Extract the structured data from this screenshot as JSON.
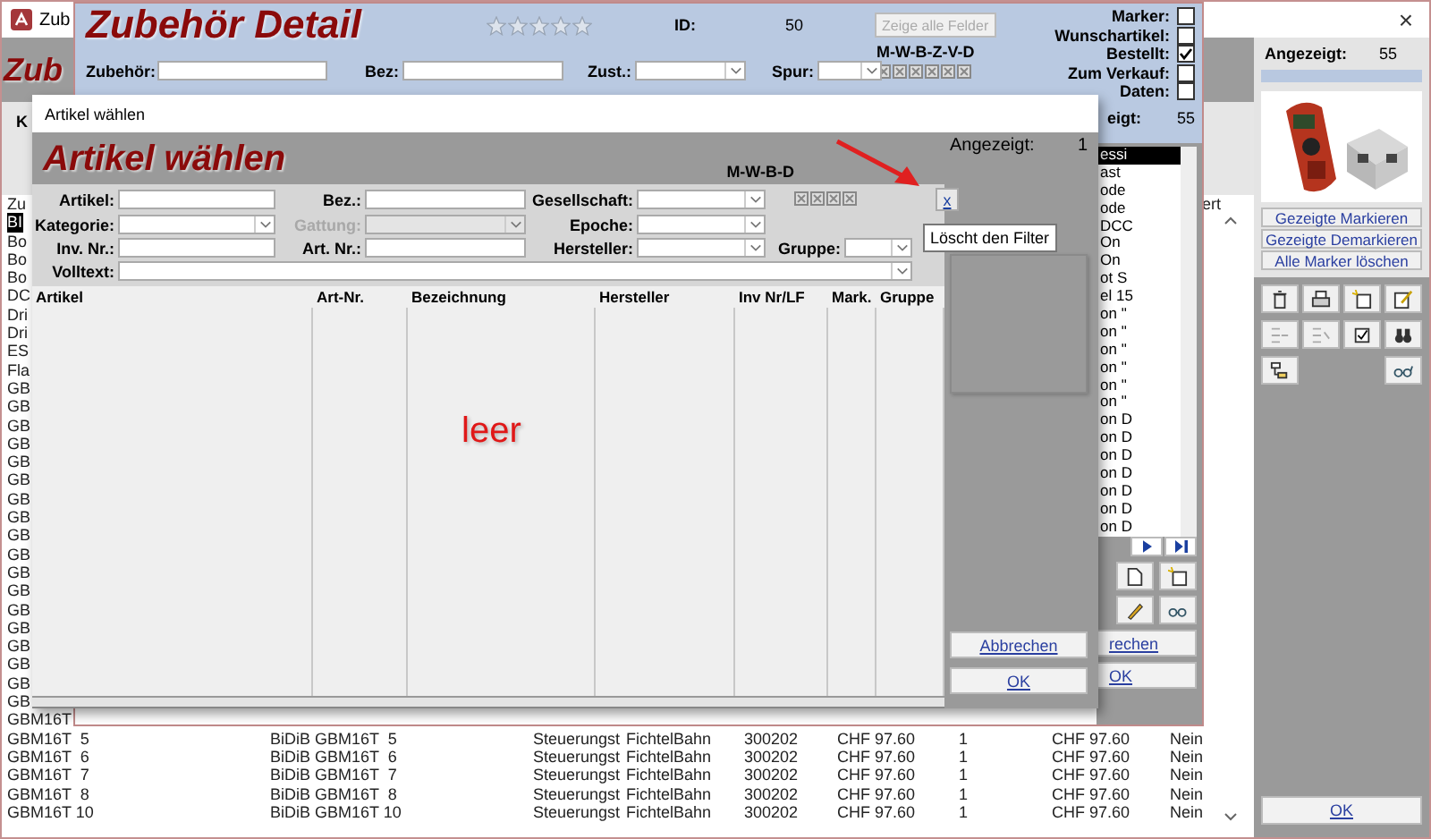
{
  "app_window": {
    "title": "Zub",
    "heading": "Zub",
    "close": "×",
    "filter_label": "K",
    "list_header": "Zu",
    "column_header": "ert",
    "rows": [
      {
        "cells": [
          "BI"
        ],
        "selected": true
      },
      {
        "cells": [
          "Bo"
        ],
        "selected": false
      },
      {
        "cells": [
          "Bo"
        ],
        "selected": false
      },
      {
        "cells": [
          "Bo"
        ],
        "selected": false
      },
      {
        "cells": [
          "DC"
        ],
        "selected": false
      },
      {
        "cells": [
          "Dri"
        ],
        "selected": false
      },
      {
        "cells": [
          "Dri"
        ],
        "selected": false
      },
      {
        "cells": [
          "ES"
        ],
        "selected": false
      },
      {
        "cells": [
          "Fla"
        ],
        "selected": false
      },
      {
        "cells": [
          "GB"
        ],
        "selected": false
      },
      {
        "cells": [
          "GB"
        ],
        "selected": false
      },
      {
        "cells": [
          "GB"
        ],
        "selected": false
      },
      {
        "cells": [
          "GB"
        ],
        "selected": false
      },
      {
        "cells": [
          "GB"
        ],
        "selected": false
      },
      {
        "cells": [
          "GB"
        ],
        "selected": false
      },
      {
        "cells": [
          "GB"
        ],
        "selected": false
      },
      {
        "cells": [
          "GB"
        ],
        "selected": false
      },
      {
        "cells": [
          "GB"
        ],
        "selected": false
      },
      {
        "cells": [
          "GB"
        ],
        "selected": false
      },
      {
        "cells": [
          "GB"
        ],
        "selected": false
      },
      {
        "cells": [
          "GB"
        ],
        "selected": false
      },
      {
        "cells": [
          "GB"
        ],
        "selected": false
      },
      {
        "cells": [
          "GB"
        ],
        "selected": false
      },
      {
        "cells": [
          "GB"
        ],
        "selected": false
      },
      {
        "cells": [
          "GB"
        ],
        "selected": false
      },
      {
        "cells": [
          "GB"
        ],
        "selected": false
      },
      {
        "cells": [
          "GB"
        ],
        "selected": false
      },
      {
        "cells": [
          "GBM16T"
        ],
        "selected": false
      },
      {
        "cells": [
          "GBM16T  5",
          "BiDiB GBM16T  5",
          "Steuerungst",
          "FichtelBahn",
          "300202",
          "CHF 97.60",
          "1",
          "CHF 97.60",
          "Nein"
        ],
        "selected": false
      },
      {
        "cells": [
          "GBM16T  6",
          "BiDiB GBM16T  6",
          "Steuerungst",
          "FichtelBahn",
          "300202",
          "CHF 97.60",
          "1",
          "CHF 97.60",
          "Nein"
        ],
        "selected": false
      },
      {
        "cells": [
          "GBM16T  7",
          "BiDiB GBM16T  7",
          "Steuerungst",
          "FichtelBahn",
          "300202",
          "CHF 97.60",
          "1",
          "CHF 97.60",
          "Nein"
        ],
        "selected": false
      },
      {
        "cells": [
          "GBM16T  8",
          "BiDiB GBM16T  8",
          "Steuerungst",
          "FichtelBahn",
          "300202",
          "CHF 97.60",
          "1",
          "CHF 97.60",
          "Nein"
        ],
        "selected": false
      },
      {
        "cells": [
          "GBM16T 10",
          "BiDiB GBM16T 10",
          "Steuerungst",
          "FichtelBahn",
          "300202",
          "CHF 97.60",
          "1",
          "CHF 97.60",
          "Nein"
        ],
        "selected": false
      }
    ],
    "side_panel": {
      "shown_label": "Angezeigt:",
      "shown_count": "55",
      "buttons": [
        "Gezeigte Markieren",
        "Gezeigte Demarkieren",
        "Alle Marker löschen"
      ],
      "ok_button": "OK"
    }
  },
  "detail_window": {
    "heading": "Zubehör Detail",
    "stars": 0,
    "id_label": "ID:",
    "id_value": "50",
    "show_all_button": {
      "label": "Zeige alle Felder",
      "disabled": true
    },
    "flags_label": "M-W-B-Z-V-D",
    "fields": [
      {
        "label": "Zubehör:",
        "kind": "text",
        "disabled": false
      },
      {
        "label": "Bez:",
        "kind": "text",
        "disabled": false
      },
      {
        "label": "Zust.:",
        "kind": "dropdown",
        "disabled": false
      },
      {
        "label": "Spur:",
        "kind": "dropdown",
        "disabled": false
      }
    ],
    "checks": [
      {
        "label": "Marker:",
        "checked": false
      },
      {
        "label": "Wunschartikel:",
        "checked": false
      },
      {
        "label": "Bestellt:",
        "checked": true
      },
      {
        "label": "Zum Verkauf:",
        "checked": false
      },
      {
        "label": "Daten:",
        "checked": false
      }
    ],
    "shown_label": "eigt:",
    "shown_count": "55",
    "list": [
      {
        "text": "essi",
        "selected": true
      },
      {
        "text": "ast",
        "selected": false
      },
      {
        "text": "ode",
        "selected": false
      },
      {
        "text": "ode",
        "selected": false
      },
      {
        "text": "DCC",
        "selected": false
      },
      {
        "text": "On",
        "selected": false
      },
      {
        "text": "On",
        "selected": false
      },
      {
        "text": "ot S",
        "selected": false
      },
      {
        "text": "el 15",
        "selected": false
      },
      {
        "text": "on \"",
        "selected": false
      },
      {
        "text": "on \"",
        "selected": false
      },
      {
        "text": "on \"",
        "selected": false
      },
      {
        "text": "on \"",
        "selected": false
      },
      {
        "text": "on \"",
        "selected": false
      },
      {
        "text": "on \"",
        "selected": false
      },
      {
        "text": "on D",
        "selected": false
      },
      {
        "text": "on D",
        "selected": false
      },
      {
        "text": "on D",
        "selected": false
      },
      {
        "text": "on D",
        "selected": false
      },
      {
        "text": "on D",
        "selected": false
      },
      {
        "text": "on D",
        "selected": false
      },
      {
        "text": "on D",
        "selected": false
      }
    ],
    "cancel_button": "rechen",
    "ok_button": "OK"
  },
  "dialog": {
    "title": "Artikel wählen",
    "heading": "Artikel wählen",
    "shown_label": "Angezeigt:",
    "shown_count": "1",
    "flags_label": "M-W-B-D",
    "filter_clear": "x",
    "tooltip": "Löscht den Filter",
    "fields": [
      {
        "label": "Artikel:",
        "kind": "text",
        "disabled": false
      },
      {
        "label": "Bez.:",
        "kind": "text",
        "disabled": false
      },
      {
        "label": "Gesellschaft:",
        "kind": "dropdown",
        "disabled": false
      },
      {
        "label": "Kategorie:",
        "kind": "dropdown",
        "disabled": false
      },
      {
        "label": "Gattung:",
        "kind": "dropdown",
        "disabled": true
      },
      {
        "label": "Epoche:",
        "kind": "dropdown",
        "disabled": false
      },
      {
        "label": "Inv. Nr.:",
        "kind": "text",
        "disabled": false
      },
      {
        "label": "Art. Nr.:",
        "kind": "text",
        "disabled": false
      },
      {
        "label": "Hersteller:",
        "kind": "dropdown",
        "disabled": false
      },
      {
        "label": "Gruppe:",
        "kind": "dropdown",
        "disabled": false
      },
      {
        "label": "Volltext:",
        "kind": "wide",
        "disabled": false
      }
    ],
    "columns": [
      "Artikel",
      "Art-Nr.",
      "Bezeichnung",
      "Hersteller",
      "Inv Nr/LF",
      "Mark.",
      "Gruppe"
    ],
    "empty_note": "leer",
    "cancel_button": "Abbrechen",
    "ok_button": "OK"
  }
}
